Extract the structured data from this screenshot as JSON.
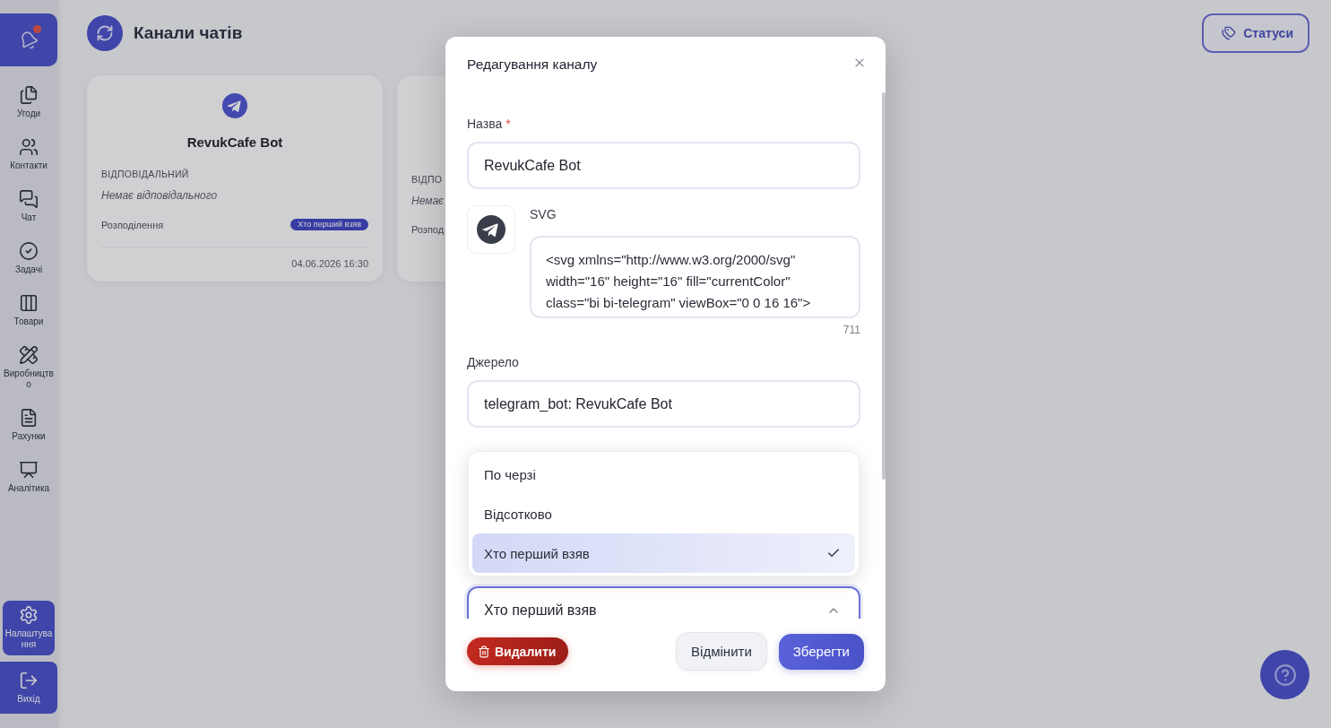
{
  "sidebar": {
    "has_notifications": true,
    "items": [
      {
        "label": "Угоди",
        "kind": "deals",
        "selected": false
      },
      {
        "label": "Контакти",
        "kind": "contacts",
        "selected": false
      },
      {
        "label": "Чат",
        "kind": "chat",
        "selected": false
      },
      {
        "label": "Задачі",
        "kind": "tasks",
        "selected": false
      },
      {
        "label": "Товари",
        "kind": "products",
        "selected": false
      },
      {
        "label": "Виробництво",
        "kind": "production",
        "selected": false
      },
      {
        "label": "Рахунки",
        "kind": "invoices",
        "selected": false
      },
      {
        "label": "Аналітика",
        "kind": "analytics",
        "selected": false
      }
    ],
    "footer_items": [
      {
        "label": "Налаштування",
        "kind": "settings",
        "selected": true
      }
    ],
    "logout": {
      "label": "Вихід"
    }
  },
  "header": {
    "title": "Канали чатів",
    "statuses_button": "Статуси"
  },
  "channels": [
    {
      "kind": "telegram",
      "name": "RevukCafe Bot",
      "responsible_label": "ВІДПОВІДАЛЬНИЙ",
      "responsible_value": "Немає відповідального",
      "distribution_label": "Розподілення",
      "distribution": "Хто перший взяв",
      "date": "04.06.2026 16:30"
    },
    {
      "responsible_label": "ВІДПО",
      "responsible_value": "Немає",
      "distribution_label": "Розпод"
    }
  ],
  "dialog": {
    "title": "Редагування каналу",
    "fields": [
      {
        "kind": "text",
        "label": "Назва",
        "required_mark": "*",
        "value": "RevukCafe Bot"
      },
      {
        "kind": "code",
        "label": "SVG",
        "value": "<svg xmlns=\"http://www.w3.org/2000/svg\" width=\"16\" height=\"16\" fill=\"currentColor\" class=\"bi bi-telegram\" viewBox=\"0 0 16 16\">",
        "counter": "711"
      },
      {
        "kind": "text",
        "label": "Джерело",
        "value": "telegram_bot: RevukCafe Bot"
      },
      {
        "kind": "select",
        "value": "Хто перший взяв",
        "expanded": true,
        "options": [
          {
            "label": "По черзі",
            "selected": false
          },
          {
            "label": "Відсотково",
            "selected": false
          },
          {
            "label": "Хто перший взяв",
            "selected": true
          }
        ]
      }
    ],
    "buttons": [
      {
        "kind": "danger",
        "label": "Видалити"
      },
      {
        "kind": "secondary",
        "label": "Відмінити"
      },
      {
        "kind": "primary",
        "label": "Зберегти"
      }
    ]
  }
}
